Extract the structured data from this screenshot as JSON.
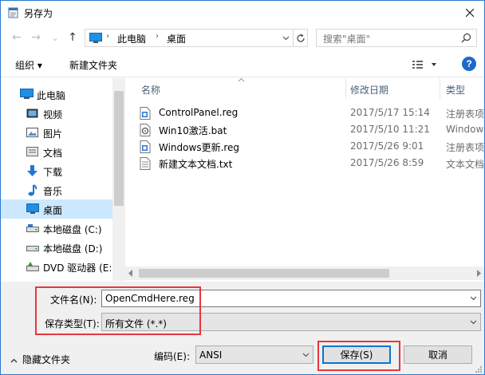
{
  "window": {
    "title": "另存为"
  },
  "nav": {
    "back": "←",
    "forward": "→",
    "recent": "⌄",
    "up": "↑"
  },
  "address": {
    "crumbs": [
      "此电脑",
      "桌面"
    ],
    "separator": "›"
  },
  "search": {
    "placeholder": "搜索\"桌面\""
  },
  "toolbar": {
    "organize": "组织 ▾",
    "new_folder": "新建文件夹",
    "help": "?"
  },
  "sidebar": {
    "items": [
      {
        "label": "此电脑",
        "icon": "computer-icon",
        "selected": false
      },
      {
        "label": "视频",
        "icon": "video-folder-icon",
        "selected": false
      },
      {
        "label": "图片",
        "icon": "pictures-folder-icon",
        "selected": false
      },
      {
        "label": "文档",
        "icon": "documents-folder-icon",
        "selected": false
      },
      {
        "label": "下载",
        "icon": "download-arrow-icon",
        "selected": false
      },
      {
        "label": "音乐",
        "icon": "music-note-icon",
        "selected": false
      },
      {
        "label": "桌面",
        "icon": "desktop-icon",
        "selected": true
      },
      {
        "label": "本地磁盘 (C:)",
        "icon": "drive-icon",
        "selected": false
      },
      {
        "label": "本地磁盘 (D:)",
        "icon": "drive-icon",
        "selected": false
      },
      {
        "label": "DVD 驱动器 (E:)",
        "icon": "dvd-drive-icon",
        "selected": false
      }
    ]
  },
  "file_list": {
    "columns": [
      "名称",
      "修改日期",
      "类型"
    ],
    "files": [
      {
        "name": "ControlPanel.reg",
        "date": "2017/5/17 15:14",
        "type": "注册表项",
        "icon": "reg-file-icon"
      },
      {
        "name": "Win10激活.bat",
        "date": "2017/5/10 11:21",
        "type": "Windows",
        "icon": "bat-file-icon"
      },
      {
        "name": "Windows更新.reg",
        "date": "2017/5/26 9:01",
        "type": "注册表项",
        "icon": "reg-file-icon"
      },
      {
        "name": "新建文本文档.txt",
        "date": "2017/5/26 8:59",
        "type": "文本文档",
        "icon": "txt-file-icon"
      }
    ]
  },
  "save": {
    "filename_label": "文件名(N):",
    "filename_value": "OpenCmdHere.reg",
    "filetype_label": "保存类型(T):",
    "filetype_value": "所有文件 (*.*)",
    "hide_folders": "隐藏文件夹",
    "encoding_label": "编码(E):",
    "encoding_value": "ANSI",
    "save_button": "保存(S)",
    "cancel_button": "取消"
  },
  "colors": {
    "accent": "#0078d7",
    "selected_bg": "#cce8ff",
    "highlight_box": "#e8373c",
    "dialog_bg": "#f0f0f0"
  }
}
